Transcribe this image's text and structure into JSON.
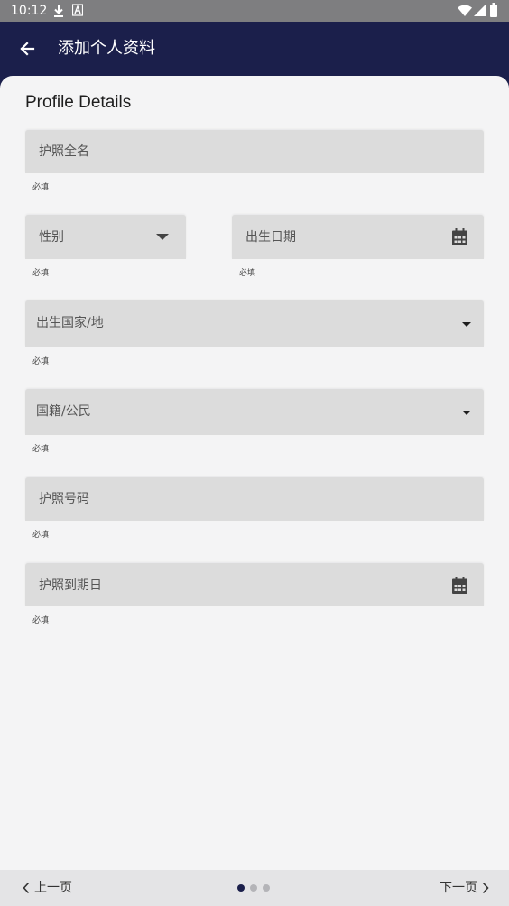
{
  "status_bar": {
    "time": "10:12",
    "icons": [
      "download-icon",
      "font-icon",
      "wifi-icon",
      "signal-icon",
      "battery-icon"
    ]
  },
  "app_bar": {
    "title": "添加个人资料",
    "back_icon": "arrow-left-icon"
  },
  "form": {
    "section_title": "Profile Details",
    "fields": {
      "passport_name": {
        "label": "护照全名",
        "helper": "必填"
      },
      "gender": {
        "label": "性别",
        "helper": "必填",
        "icon": "caret-down-icon"
      },
      "birth_date": {
        "label": "出生日期",
        "helper": "必填",
        "icon": "calendar-icon"
      },
      "birth_country": {
        "label": "出生国家/地",
        "helper": "必填",
        "icon": "caret-down-icon"
      },
      "nationality": {
        "label": "国籍/公民",
        "helper": "必填",
        "icon": "caret-down-icon"
      },
      "passport_number": {
        "label": "护照号码",
        "helper": "必填"
      },
      "passport_expiry": {
        "label": "护照到期日",
        "helper": "必填",
        "icon": "calendar-icon"
      }
    }
  },
  "footer": {
    "prev_label": "上一页",
    "next_label": "下一页",
    "page_total": 3,
    "page_current": 1
  },
  "colors": {
    "app_bar": "#1b1f4b",
    "status_bar": "#7e7e80",
    "background": "#f4f4f5",
    "field": "#dcdcdc",
    "footer": "#e4e4e6"
  }
}
